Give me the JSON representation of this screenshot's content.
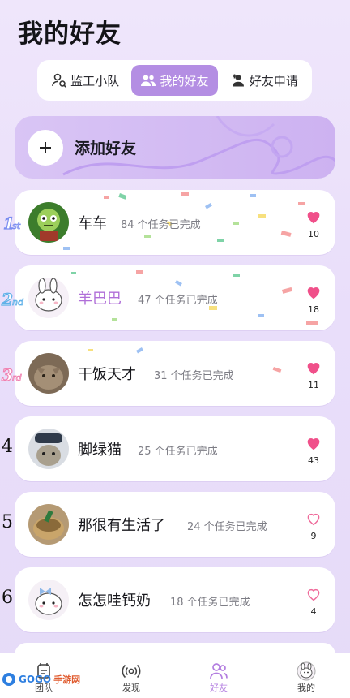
{
  "page": {
    "title": "我的好友"
  },
  "tabs": [
    {
      "label": "监工小队",
      "icon": "supervisor-icon",
      "active": false
    },
    {
      "label": "我的好友",
      "icon": "friends-icon",
      "active": true
    },
    {
      "label": "好友申请",
      "icon": "add-friend-icon",
      "active": false
    }
  ],
  "add_friend": {
    "label": "添加好友",
    "icon": "plus-icon"
  },
  "friends": [
    {
      "rank": "1st",
      "name": "车车",
      "tasks": "84 个任务已完成",
      "likes": "10",
      "liked": true,
      "avatar": "zombie-avatar"
    },
    {
      "rank": "2nd",
      "name": "羊巴巴",
      "tasks": "47 个任务已完成",
      "likes": "18",
      "liked": true,
      "avatar": "bunny-avatar"
    },
    {
      "rank": "3rd",
      "name": "干饭天才",
      "tasks": "31 个任务已完成",
      "likes": "11",
      "liked": true,
      "avatar": "cat-photo-avatar"
    },
    {
      "rank": "4",
      "name": "脚绿猫",
      "tasks": "25 个任务已完成",
      "likes": "43",
      "liked": true,
      "avatar": "cat-cap-avatar"
    },
    {
      "rank": "5",
      "name": "那很有生活了",
      "tasks": "24 个任务已完成",
      "likes": "9",
      "liked": false,
      "avatar": "bread-avatar"
    },
    {
      "rank": "6",
      "name": "怎怎哇钙奶",
      "tasks": "18 个任务已完成",
      "likes": "4",
      "liked": false,
      "avatar": "bunny-bow-avatar"
    }
  ],
  "nav": [
    {
      "label": "团队",
      "icon": "team-icon",
      "active": false
    },
    {
      "label": "发现",
      "icon": "broadcast-icon",
      "active": false
    },
    {
      "label": "好友",
      "icon": "friends-icon",
      "active": true
    },
    {
      "label": "我的",
      "icon": "avatar-icon",
      "active": false
    }
  ],
  "watermark": {
    "text": "GOGO",
    "text2": "手游网"
  },
  "colors": {
    "accent": "#b48ee3",
    "heart": "#f0508a",
    "heart_outline": "#ef6a9a"
  }
}
